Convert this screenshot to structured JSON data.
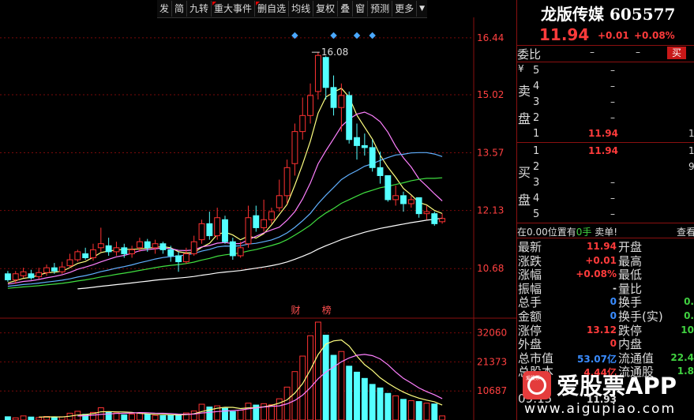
{
  "toolbar": {
    "items": [
      "发",
      "简",
      "九转",
      "重大事件",
      "删自选",
      "均线",
      "复权",
      "叠",
      "窗",
      "预测",
      "更多"
    ],
    "arrow": "▼"
  },
  "stock": {
    "name": "龙版传媒",
    "code": "605577",
    "price": "11.94",
    "change": "+0.01",
    "change_pct": "+0.08%"
  },
  "order_book": {
    "ratio_label": "委比",
    "ratio_a": "–",
    "ratio_b": "–",
    "buy_button": "买",
    "sell_side_label": [
      "卖",
      "盘"
    ],
    "buy_side_label": [
      "买",
      "盘"
    ],
    "yen": "¥",
    "sell_levels": [
      {
        "level": "5",
        "price": "",
        "vol": "–"
      },
      {
        "level": "4",
        "price": "",
        "vol": "–"
      },
      {
        "level": "3",
        "price": "",
        "vol": "–"
      },
      {
        "level": "2",
        "price": "",
        "vol": "–"
      },
      {
        "level": "1",
        "price": "11.94",
        "vol": "1"
      }
    ],
    "buy_levels": [
      {
        "level": "1",
        "price": "11.94",
        "vol": "1"
      },
      {
        "level": "2",
        "price": "",
        "vol": "9"
      },
      {
        "level": "3",
        "price": "",
        "vol": "–"
      },
      {
        "level": "4",
        "price": "",
        "vol": "–"
      },
      {
        "level": "5",
        "price": "",
        "vol": "–"
      }
    ]
  },
  "position_line": {
    "prefix": "在0.00位置有",
    "qty": "0手",
    "suffix": "卖单!",
    "view": "查看"
  },
  "stats": [
    {
      "label": "最新",
      "value": "11.94",
      "color": "#ff3b3b",
      "label2": "开盘",
      "value2": ""
    },
    {
      "label": "涨跌",
      "value": "+0.01",
      "color": "#ff3b3b",
      "label2": "最高",
      "value2": ""
    },
    {
      "label": "涨幅",
      "value": "+0.08%",
      "color": "#ff3b3b",
      "label2": "最低",
      "value2": ""
    },
    {
      "label": "振幅",
      "value": "-",
      "color": "#dddddd",
      "label2": "量比",
      "value2": ""
    },
    {
      "label": "总手",
      "value": "0",
      "color": "#3a8cff",
      "label2": "换手",
      "value2": "0."
    },
    {
      "label": "金额",
      "value": "0",
      "color": "#3a8cff",
      "label2": "换手(实)",
      "value2": "0."
    },
    {
      "label": "涨停",
      "value": "13.12",
      "color": "#ff3b3b",
      "label2": "跌停",
      "value2": "10"
    },
    {
      "label": "外盘",
      "value": "0",
      "color": "#ff3b3b",
      "label2": "内盘",
      "value2": ""
    },
    {
      "label": "总市值",
      "value": "53.07亿",
      "color": "#3a8cff",
      "label2": "流通值",
      "value2": "22.4"
    },
    {
      "label": "总股本",
      "value": "4.44亿",
      "color": "#ff3b3b",
      "label2": "流通股",
      "value2": "1.8"
    },
    {
      "label": "",
      "value": "",
      "color": "#ff3b3b",
      "label2": "",
      "value2": ""
    },
    {
      "label": "09:15",
      "value": "11.93",
      "color": "#dddddd",
      "label2": "",
      "value2": ""
    }
  ],
  "watermark": {
    "logo_text": "爱股票",
    "app_text": "爱股票APP",
    "url": "www.aigupiao.com"
  },
  "chart_data": [
    {
      "type": "candlestick",
      "title": "",
      "y_ticks": [
        16.44,
        15.02,
        13.57,
        12.13,
        10.68
      ],
      "ylim": [
        9.6,
        16.95
      ],
      "high_label": "16.08",
      "markers": [
        "财",
        "榜"
      ],
      "series": [
        {
          "name": "",
          "type": "candles",
          "values": [
            [
              10.55,
              10.4,
              10.62,
              10.35
            ],
            [
              10.4,
              10.55,
              10.62,
              10.3
            ],
            [
              10.5,
              10.6,
              10.7,
              10.45
            ],
            [
              10.55,
              10.45,
              10.65,
              10.4
            ],
            [
              10.48,
              10.58,
              10.7,
              10.42
            ],
            [
              10.58,
              10.7,
              10.78,
              10.5
            ],
            [
              10.7,
              10.62,
              10.82,
              10.55
            ],
            [
              10.6,
              10.72,
              10.85,
              10.55
            ],
            [
              10.75,
              10.9,
              11.05,
              10.7
            ],
            [
              10.9,
              11.1,
              11.15,
              10.85
            ],
            [
              11.05,
              10.95,
              11.2,
              10.9
            ],
            [
              10.95,
              11.15,
              11.3,
              10.88
            ],
            [
              11.2,
              11.3,
              11.7,
              11.1
            ],
            [
              11.25,
              11.1,
              11.45,
              11.0
            ],
            [
              11.1,
              11.2,
              11.35,
              11.0
            ],
            [
              11.2,
              11.05,
              11.3,
              10.95
            ],
            [
              11.05,
              11.15,
              11.25,
              10.95
            ],
            [
              11.2,
              11.35,
              11.45,
              11.1
            ],
            [
              11.35,
              11.2,
              11.42,
              11.1
            ],
            [
              11.2,
              11.3,
              11.4,
              11.05
            ],
            [
              11.3,
              11.15,
              11.35,
              11.05
            ],
            [
              11.15,
              11.0,
              11.25,
              10.85
            ],
            [
              11.0,
              10.85,
              11.1,
              10.6
            ],
            [
              10.85,
              11.05,
              11.2,
              10.8
            ],
            [
              11.05,
              11.35,
              11.5,
              11.0
            ],
            [
              11.4,
              11.8,
              11.9,
              11.3
            ],
            [
              11.8,
              11.5,
              12.1,
              11.4
            ],
            [
              11.5,
              11.95,
              12.2,
              11.4
            ],
            [
              11.9,
              11.35,
              12.0,
              11.3
            ],
            [
              11.35,
              11.0,
              11.45,
              10.9
            ],
            [
              11.0,
              11.2,
              11.35,
              10.95
            ],
            [
              11.3,
              11.95,
              12.25,
              11.2
            ],
            [
              12.0,
              11.7,
              12.25,
              11.6
            ],
            [
              11.7,
              11.9,
              12.4,
              11.6
            ],
            [
              11.9,
              12.1,
              12.2,
              11.8
            ],
            [
              12.2,
              12.5,
              12.9,
              12.1
            ],
            [
              12.5,
              13.2,
              13.4,
              12.3
            ],
            [
              13.3,
              14.1,
              14.3,
              13.0
            ],
            [
              14.1,
              14.5,
              14.95,
              13.9
            ],
            [
              14.5,
              15.0,
              15.3,
              14.3
            ],
            [
              15.1,
              16.0,
              16.08,
              14.9
            ],
            [
              15.95,
              15.2,
              15.98,
              14.9
            ],
            [
              15.2,
              14.7,
              15.5,
              14.5
            ],
            [
              14.7,
              15.0,
              15.3,
              14.1
            ],
            [
              15.0,
              13.9,
              15.1,
              13.8
            ],
            [
              13.95,
              13.75,
              14.3,
              13.4
            ],
            [
              13.75,
              13.7,
              14.05,
              13.5
            ],
            [
              13.7,
              13.2,
              13.9,
              13.1
            ],
            [
              13.2,
              13.0,
              13.6,
              12.8
            ],
            [
              13.0,
              12.4,
              13.0,
              12.35
            ],
            [
              12.4,
              12.5,
              12.75,
              12.25
            ],
            [
              12.5,
              12.3,
              12.6,
              12.1
            ],
            [
              12.3,
              12.4,
              12.5,
              12.2
            ],
            [
              12.45,
              12.05,
              12.45,
              11.95
            ],
            [
              12.05,
              12.1,
              12.25,
              11.9
            ],
            [
              12.05,
              11.8,
              12.1,
              11.75
            ],
            [
              11.85,
              11.93,
              12.05,
              11.8
            ]
          ]
        },
        {
          "name": "",
          "color": "#ffff80",
          "values": []
        },
        {
          "name": "",
          "color": "#ff80ff",
          "values": []
        },
        {
          "name": "",
          "color": "#40e040",
          "values": []
        },
        {
          "name": "",
          "color": "#ffffff",
          "values": []
        }
      ]
    },
    {
      "type": "bar",
      "title": "",
      "y_ticks": [
        32060,
        21373,
        10687
      ],
      "ylim": [
        0,
        36000
      ],
      "values": [
        1200,
        800,
        1500,
        1100,
        900,
        1300,
        1000,
        1200,
        2500,
        3200,
        2100,
        2800,
        4500,
        2900,
        2600,
        1900,
        2200,
        2500,
        2100,
        1700,
        1600,
        1800,
        2100,
        2600,
        3300,
        5800,
        4800,
        5200,
        4300,
        3100,
        3600,
        6200,
        5500,
        6000,
        5600,
        7800,
        12100,
        17800,
        23500,
        31000,
        36000,
        31200,
        23800,
        25200,
        19800,
        17600,
        15300,
        13100,
        11800,
        9800,
        8900,
        7600,
        7100,
        6800,
        6200,
        5900,
        1500
      ]
    }
  ]
}
